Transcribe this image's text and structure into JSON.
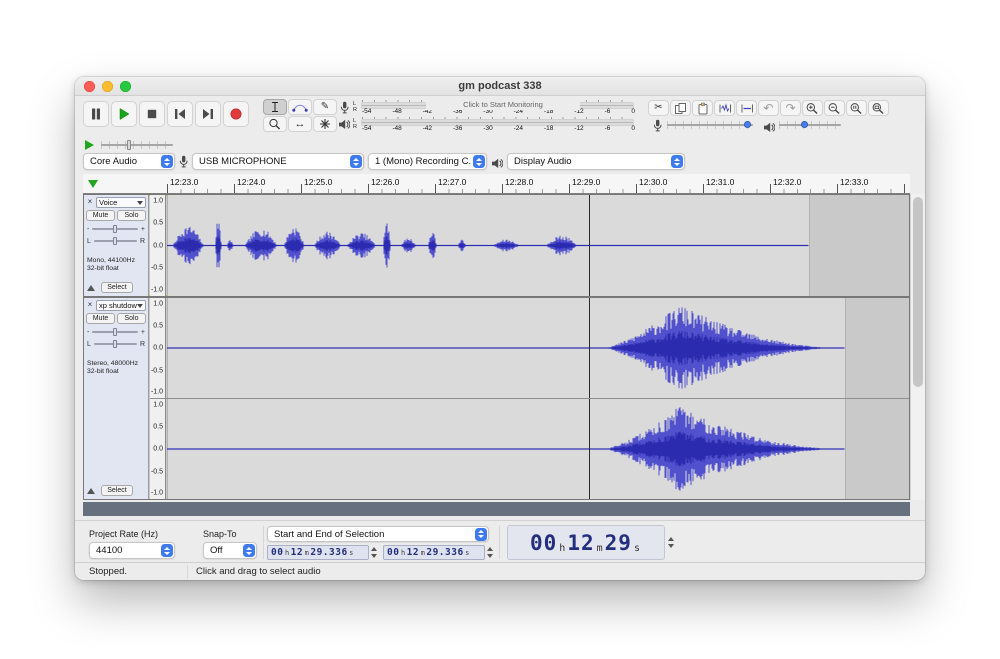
{
  "colors": {
    "accent": "#3e7bf0",
    "wave_peak": "#5151cd",
    "wave_rms": "#2b2bb0",
    "record_red": "#e03a3a",
    "play_green": "#1ca51c",
    "clip_bg": "#dadada",
    "track_bg": "#c9c9c9",
    "dark_strip": "#66707f",
    "digit_navy": "#232e7d"
  },
  "window": {
    "title": "gm podcast 338"
  },
  "meters": {
    "channels": [
      "L",
      "R"
    ],
    "monitor_text": "Click to Start Monitoring",
    "recording_scale": [
      "-54",
      "-48",
      "-42",
      "-36",
      "-30",
      "-24",
      "-18",
      "-12",
      "-6",
      "0"
    ],
    "playback_scale": [
      "-54",
      "-48",
      "-42",
      "-36",
      "-30",
      "-24",
      "-18",
      "-12",
      "-6",
      "0"
    ]
  },
  "devices": {
    "host": "Core Audio",
    "input": "USB MICROPHONE",
    "channels": "1 (Mono) Recording C...",
    "output": "Display Audio"
  },
  "timeline": {
    "labels": [
      "12:23.0",
      "12:24.0",
      "12:25.0",
      "12:26.0",
      "12:27.0",
      "12:28.0",
      "12:29.0",
      "12:30.0",
      "12:31.0",
      "12:32.0",
      "12:33.0"
    ]
  },
  "vruler": {
    "labels": [
      "1.0",
      "0.5",
      "0.0",
      "-0.5",
      "-1.0"
    ],
    "positions": [
      6,
      27.5,
      50,
      72.5,
      94
    ]
  },
  "tracks": [
    {
      "name": "Voice",
      "mute": "Mute",
      "solo": "Solo",
      "gain_min": "-",
      "gain_max": "+",
      "pan_left": "L",
      "pan_right": "R",
      "info1": "Mono, 44100Hz",
      "info2": "32-bit float",
      "select": "Select"
    },
    {
      "name": "xp shutdown",
      "mute": "Mute",
      "solo": "Solo",
      "gain_min": "-",
      "gain_max": "+",
      "pan_left": "L",
      "pan_right": "R",
      "info1": "Stereo, 48000Hz",
      "info2": "32-bit float",
      "select": "Select"
    }
  ],
  "waveforms": {
    "cursor": 0.569,
    "track1": {
      "kind": "speech",
      "clip": [
        0,
        0.866
      ],
      "active": [
        0.003,
        0.562
      ],
      "seed": 7
    },
    "track2a": {
      "kind": "swell",
      "clip": [
        0,
        0.915
      ],
      "active": [
        0.59,
        0.91
      ],
      "seed": 11
    },
    "track2b": {
      "kind": "swell",
      "clip": [
        0,
        0.915
      ],
      "active": [
        0.59,
        0.91
      ],
      "seed": 29
    }
  },
  "selection_bar": {
    "rate_label": "Project Rate (Hz)",
    "rate_value": "44100",
    "snap_label": "Snap-To",
    "snap_value": "Off",
    "mode_value": "Start and End of Selection",
    "start_parts": [
      "00",
      "h",
      "12",
      "m",
      "29.336",
      "s"
    ],
    "end_parts": [
      "00",
      "h",
      "12",
      "m",
      "29.336",
      "s"
    ],
    "big_time_parts": [
      "00",
      "h",
      "12",
      "m",
      "29",
      "s"
    ]
  },
  "status": {
    "state": "Stopped.",
    "hint": "Click and drag to select audio"
  }
}
